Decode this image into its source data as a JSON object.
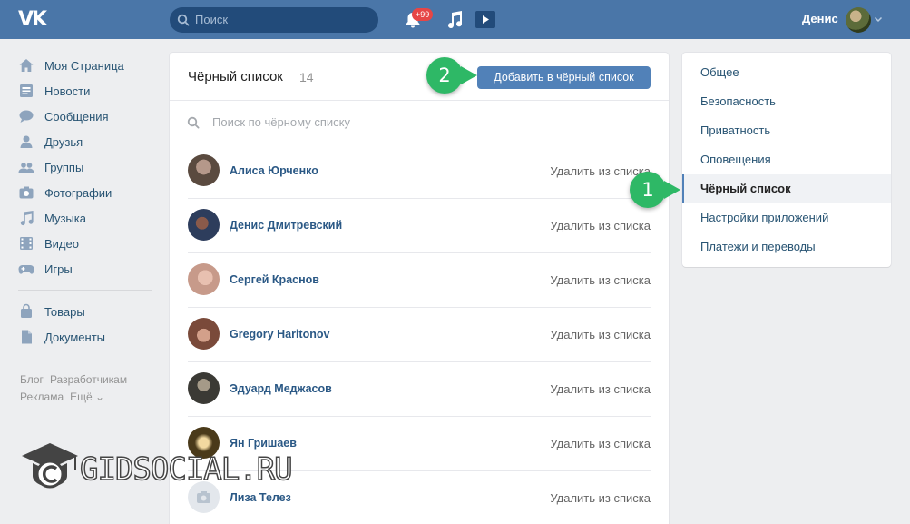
{
  "header": {
    "search_placeholder": "Поиск",
    "notification_badge": "+99",
    "user_name": "Денис",
    "logo_text": "VK"
  },
  "leftnav": {
    "items": [
      {
        "label": "Моя Страница",
        "icon": "home-icon"
      },
      {
        "label": "Новости",
        "icon": "news-icon"
      },
      {
        "label": "Сообщения",
        "icon": "messages-icon"
      },
      {
        "label": "Друзья",
        "icon": "friend-icon"
      },
      {
        "label": "Группы",
        "icon": "groups-icon"
      },
      {
        "label": "Фотографии",
        "icon": "camera-icon"
      },
      {
        "label": "Музыка",
        "icon": "music-icon"
      },
      {
        "label": "Видео",
        "icon": "video-icon"
      },
      {
        "label": "Игры",
        "icon": "gamepad-icon"
      }
    ],
    "items2": [
      {
        "label": "Товары",
        "icon": "bag-icon"
      },
      {
        "label": "Документы",
        "icon": "document-icon"
      }
    ],
    "footer": [
      "Блог",
      "Разработчикам",
      "Реклама",
      "Ещё ⌄"
    ]
  },
  "main": {
    "title": "Чёрный список",
    "count": "14",
    "add_button": "Добавить в чёрный список",
    "search_placeholder": "Поиск по чёрному списку",
    "remove_label": "Удалить из списка",
    "rows": [
      {
        "name": "Алиса Юрченко",
        "color": "#5a4a3f"
      },
      {
        "name": "Денис Дмитревский",
        "color": "#2d3d5c"
      },
      {
        "name": "Сергей Краснов",
        "color": "#c79a8a"
      },
      {
        "name": "Gregory Haritonov",
        "color": "#7a4a3a"
      },
      {
        "name": "Эдуард Меджасов",
        "color": "#3b3a35"
      },
      {
        "name": "Ян Гришаев",
        "color": "#4a3a1a"
      },
      {
        "name": "Лиза Телез",
        "color": "#e3e7ec"
      }
    ]
  },
  "rightmenu": {
    "items": [
      "Общее",
      "Безопасность",
      "Приватность",
      "Оповещения",
      "Чёрный список",
      "Настройки приложений",
      "Платежи и переводы"
    ],
    "active_index": 4
  },
  "callouts": {
    "one": "1",
    "two": "2"
  },
  "watermark": "GIDSOCIAL.RU",
  "colors": {
    "header": "#4a76a8",
    "accent": "#5181b8",
    "callout": "#2eb866"
  }
}
